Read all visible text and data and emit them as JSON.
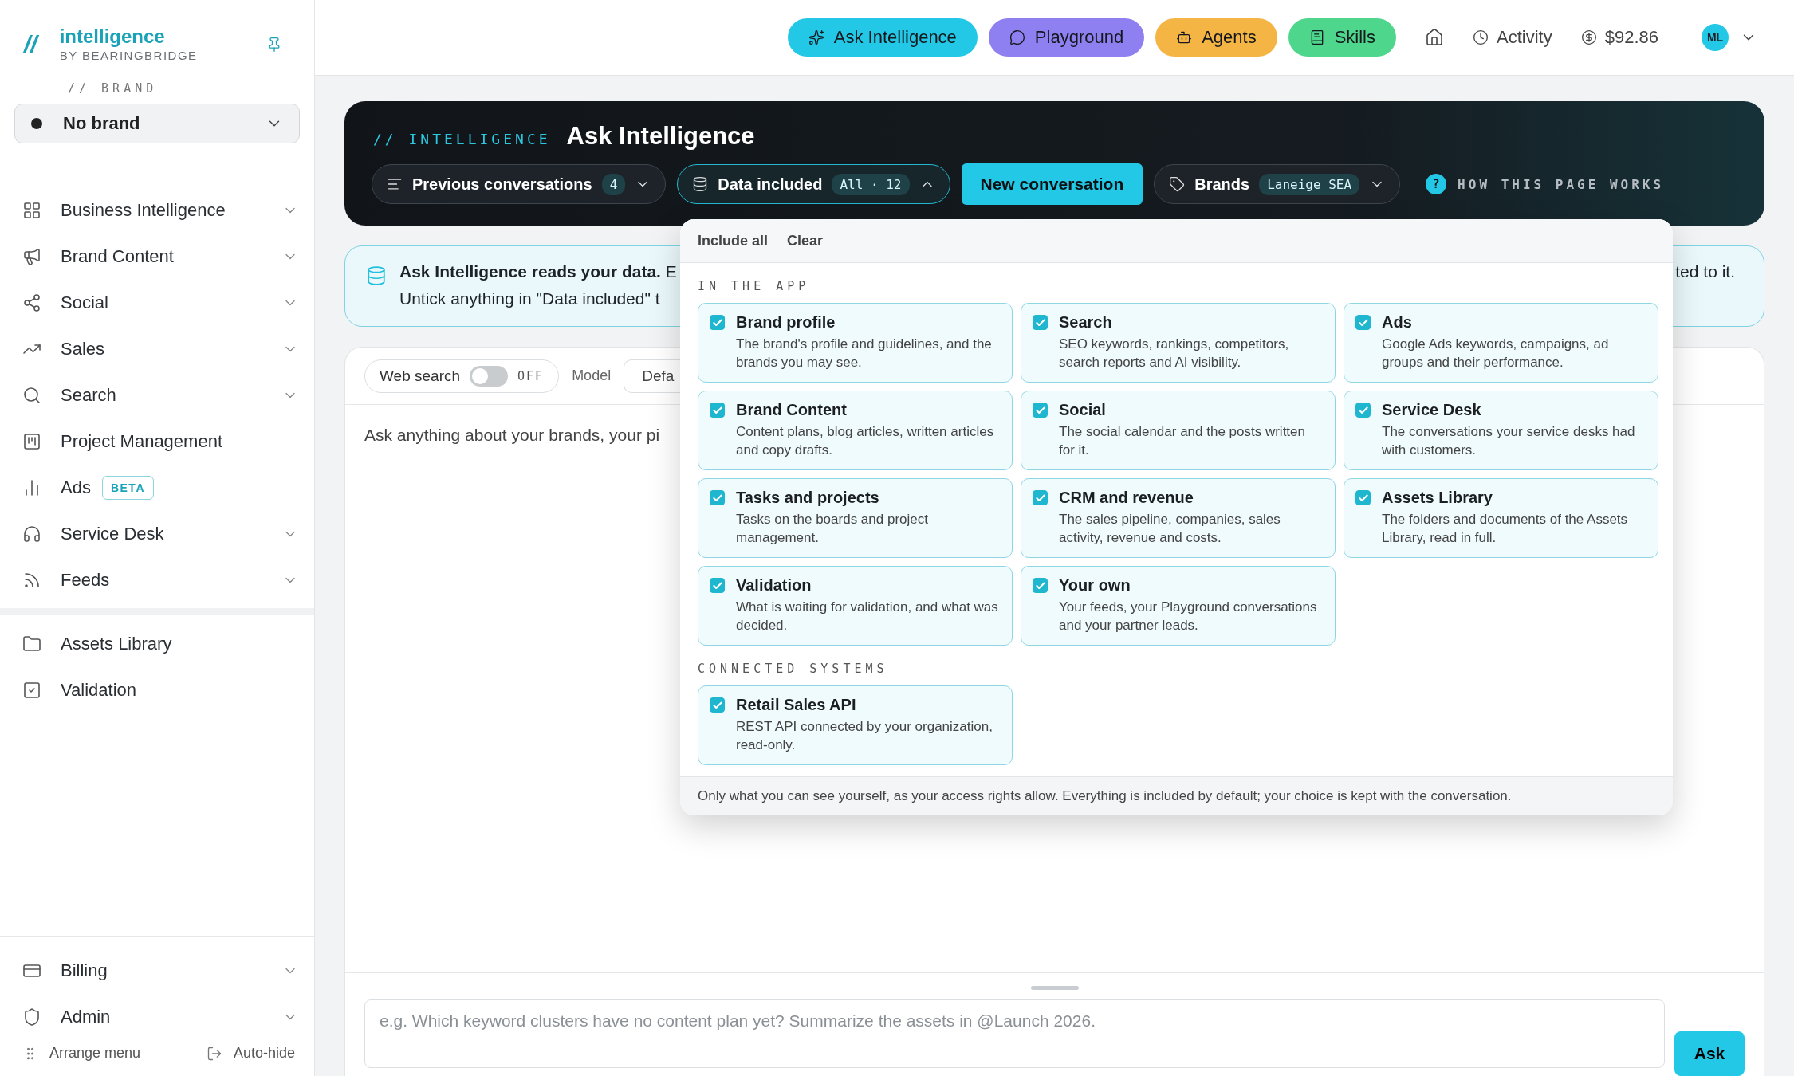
{
  "logo": {
    "mark": "//",
    "name": "intelligence",
    "byline": "BY BEARINGBRIDGE"
  },
  "brand_picker": {
    "label": "// BRAND",
    "value": "No brand"
  },
  "nav": [
    {
      "label": "Business Intelligence",
      "expandable": true
    },
    {
      "label": "Brand Content",
      "expandable": true
    },
    {
      "label": "Social",
      "expandable": true
    },
    {
      "label": "Sales",
      "expandable": true
    },
    {
      "label": "Search",
      "expandable": true
    },
    {
      "label": "Project Management",
      "expandable": false
    },
    {
      "label": "Ads",
      "badge": "BETA",
      "expandable": false
    },
    {
      "label": "Service Desk",
      "expandable": true
    },
    {
      "label": "Feeds",
      "expandable": true
    }
  ],
  "nav_secondary": [
    {
      "label": "Assets Library"
    },
    {
      "label": "Validation"
    }
  ],
  "nav_bottom": [
    {
      "label": "Billing",
      "expandable": true
    },
    {
      "label": "Admin",
      "expandable": true
    }
  ],
  "sidebar_footer": [
    "Arrange menu",
    "Auto-hide"
  ],
  "top_bar": {
    "pills": [
      {
        "label": "Ask Intelligence",
        "color": "#22c8e6"
      },
      {
        "label": "Playground",
        "color": "#8f80f2"
      },
      {
        "label": "Agents",
        "color": "#f5b544"
      },
      {
        "label": "Skills",
        "color": "#4dd68c"
      }
    ],
    "activity": "Activity",
    "balance": "$92.86",
    "avatar": "ML"
  },
  "header": {
    "eyebrow": "// INTELLIGENCE",
    "title": "Ask Intelligence",
    "previous": {
      "label": "Previous conversations",
      "count": "4"
    },
    "data_included": {
      "label": "Data included",
      "value": "All · 12",
      "expanded": true
    },
    "new_button": "New conversation",
    "brands": {
      "label": "Brands",
      "value": "Laneige SEA"
    },
    "help": {
      "icon": "?",
      "label": "HOW THIS PAGE WORKS"
    }
  },
  "banner": {
    "line_1": "**Ask Intelligence reads your data.** E",
    "line_2": "Untick anything in \"Data included\" t",
    "line_1_end": "ted to it."
  },
  "chat": {
    "web_search": {
      "label": "Web search",
      "on": false,
      "state": "OFF"
    },
    "model_label": "Model",
    "model_value": "Defa",
    "prompt": "Ask anything about your brands, your pi"
  },
  "composer": {
    "placeholder": "e.g. Which keyword clusters have no content plan yet? Summarize the assets in @Launch 2026.",
    "button": "Ask"
  },
  "data_menu": {
    "actions": [
      "Include all",
      "Clear"
    ],
    "sections": [
      {
        "title": "IN THE APP",
        "items": [
          {
            "title": "Brand profile",
            "text": "The brand's profile and guidelines, and the brands you may see.",
            "checked": true
          },
          {
            "title": "Search",
            "text": "SEO keywords, rankings, competitors, search reports and AI visibility.",
            "checked": true
          },
          {
            "title": "Ads",
            "text": "Google Ads keywords, campaigns, ad groups and their performance.",
            "checked": true
          },
          {
            "title": "Brand Content",
            "text": "Content plans, blog articles, written articles and copy drafts.",
            "checked": true
          },
          {
            "title": "Social",
            "text": "The social calendar and the posts written for it.",
            "checked": true
          },
          {
            "title": "Service Desk",
            "text": "The conversations your service desks had with customers.",
            "checked": true
          },
          {
            "title": "Tasks and projects",
            "text": "Tasks on the boards and project management.",
            "checked": true
          },
          {
            "title": "CRM and revenue",
            "text": "The sales pipeline, companies, sales activity, revenue and costs.",
            "checked": true
          },
          {
            "title": "Assets Library",
            "text": "The folders and documents of the Assets Library, read in full.",
            "checked": true
          },
          {
            "title": "Validation",
            "text": "What is waiting for validation, and what was decided.",
            "checked": true
          },
          {
            "title": "Your own",
            "text": "Your feeds, your Playground conversations and your partner leads.",
            "checked": true
          }
        ]
      },
      {
        "title": "CONNECTED SYSTEMS",
        "items": [
          {
            "title": "Retail Sales API",
            "text": "REST API connected by your organization, read-only.",
            "checked": true
          }
        ]
      }
    ],
    "footnote": "Only what you can see yourself, as your access rights allow. Everything is included by default; your choice is kept with the conversation."
  }
}
